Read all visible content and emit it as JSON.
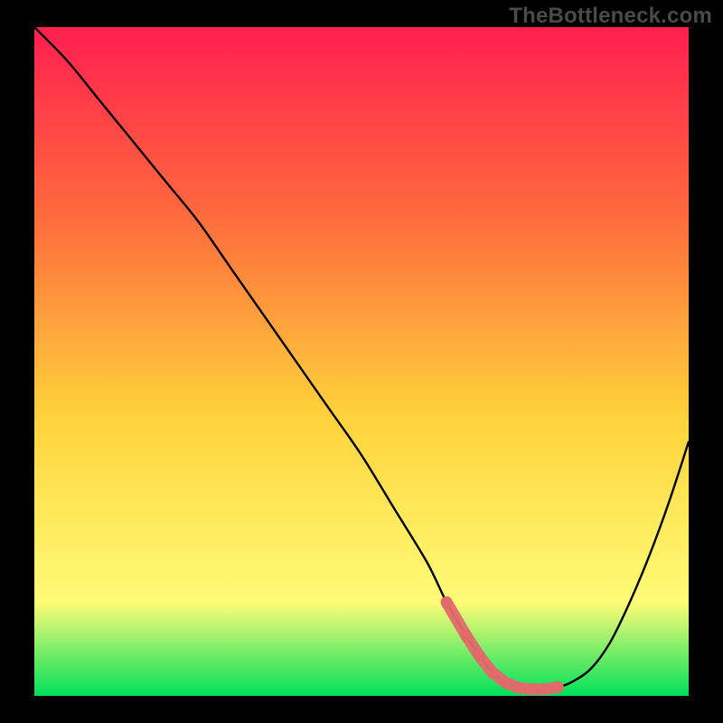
{
  "watermark": "TheBottleneck.com",
  "colors": {
    "background": "#000000",
    "gradient_top": "#ff1f4f",
    "gradient_mid_upper": "#ff6a3d",
    "gradient_mid": "#ffd23a",
    "gradient_lower": "#fffc77",
    "gradient_bottom": "#00e05a",
    "curve": "#000000",
    "marker_fill": "#e16a6a",
    "marker_stroke": "#c94f4f"
  },
  "chart_data": {
    "type": "line",
    "title": "",
    "xlabel": "",
    "ylabel": "",
    "xlim": [
      0,
      100
    ],
    "ylim": [
      0,
      100
    ],
    "x": [
      0,
      5,
      10,
      15,
      20,
      25,
      30,
      35,
      40,
      45,
      50,
      55,
      60,
      63,
      66,
      68,
      70,
      72,
      74,
      76,
      78,
      80,
      82,
      85,
      88,
      91,
      94,
      97,
      100
    ],
    "values": [
      100,
      95,
      89,
      83,
      77,
      71,
      64,
      57,
      50,
      43,
      36,
      28,
      20,
      14,
      9,
      6,
      3.5,
      2,
      1.2,
      1,
      1,
      1.3,
      2,
      4,
      8,
      14,
      21,
      29,
      38
    ],
    "markers_x": [
      63,
      66,
      68,
      70,
      72,
      74,
      76,
      78,
      80
    ],
    "markers_y": [
      14,
      9,
      6,
      3.5,
      2,
      1.2,
      1,
      1,
      1.3
    ]
  }
}
